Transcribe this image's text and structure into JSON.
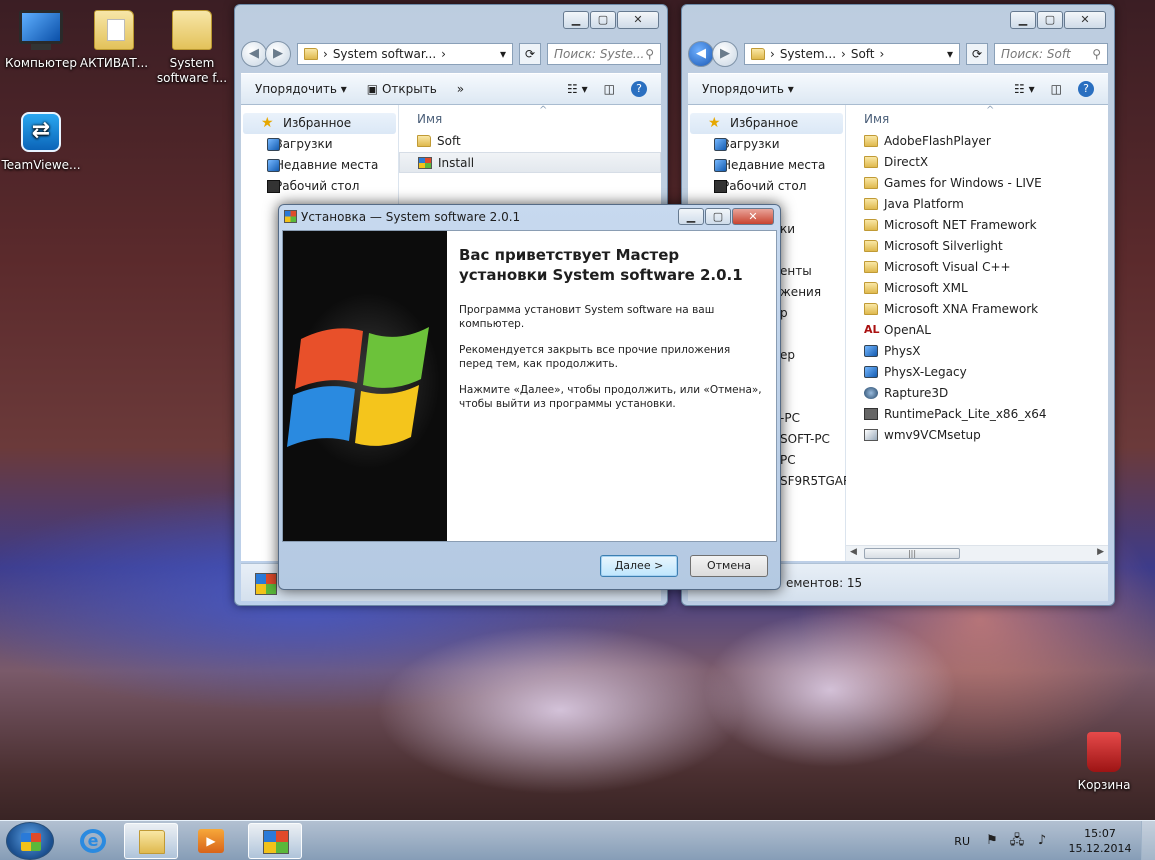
{
  "desktop": {
    "icons": [
      {
        "label": "Компьютер"
      },
      {
        "label": "АКТИВАТ..."
      },
      {
        "label": "System software f..."
      },
      {
        "label": "TeamViewe..."
      },
      {
        "label": "Корзина"
      }
    ]
  },
  "explorer_left": {
    "address": "System softwar...",
    "search_placeholder": "Поиск: Syste...",
    "toolbar": {
      "organize": "Упорядочить",
      "open": "Открыть",
      "more": "»"
    },
    "nav": {
      "favorites": "Избранное",
      "items": [
        "Загрузки",
        "Недавние места",
        "Рабочий стол"
      ]
    },
    "column": "Имя",
    "files": [
      "Soft",
      "Install"
    ]
  },
  "explorer_right": {
    "address_part1": "System...",
    "address_part2": "Soft",
    "search_placeholder": "Поиск: Soft",
    "toolbar": {
      "organize": "Упорядочить"
    },
    "nav": {
      "favorites": "Избранное",
      "items": [
        "Загрузки",
        "Недавние места",
        "Рабочий стол"
      ],
      "partial": [
        "ки",
        "енты",
        "жения",
        "р",
        "ер",
        "-PC",
        "SOFT-PC",
        "PC",
        "SF9R5TGAR"
      ]
    },
    "column": "Имя",
    "files": [
      "AdobeFlashPlayer",
      "DirectX",
      "Games for Windows - LIVE",
      "Java Platform",
      "Microsoft NET Framework",
      "Microsoft Silverlight",
      "Microsoft Visual C++",
      "Microsoft XML",
      "Microsoft XNA Framework",
      "OpenAL",
      "PhysX",
      "PhysX-Legacy",
      "Rapture3D",
      "RuntimePack_Lite_x86_x64",
      "wmv9VCMsetup"
    ],
    "status": "ементов: 15"
  },
  "installer": {
    "title": "Установка — System software 2.0.1",
    "heading": "Вас приветствует Мастер установки System software 2.0.1",
    "p1": "Программа установит System software на ваш компьютер.",
    "p2": "Рекомендуется закрыть все прочие приложения перед тем, как продолжить.",
    "p3": "Нажмите «Далее», чтобы продолжить, или «Отмена», чтобы выйти из программы установки.",
    "next": "Далее >",
    "cancel": "Отмена"
  },
  "taskbar": {
    "lang": "RU",
    "time": "15:07",
    "date": "15.12.2014"
  }
}
